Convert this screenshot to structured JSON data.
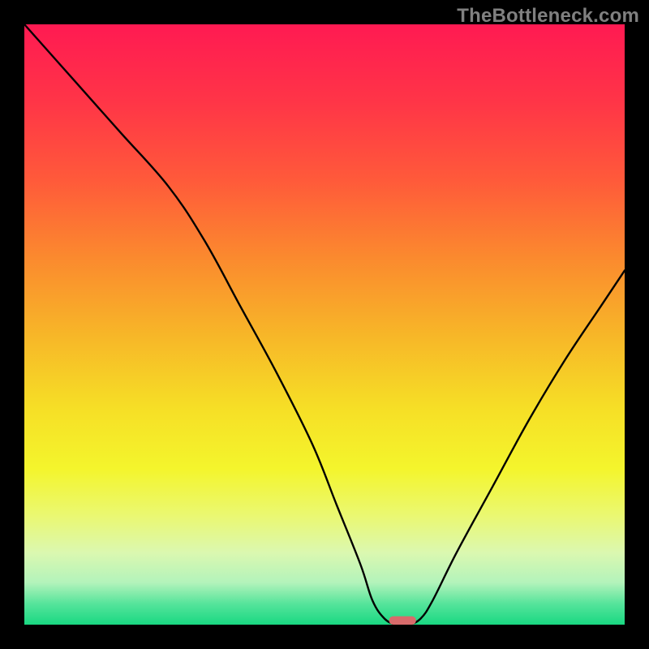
{
  "watermark": "TheBottleneck.com",
  "chart_data": {
    "type": "line",
    "title": "",
    "xlabel": "",
    "ylabel": "",
    "xlim": [
      0,
      100
    ],
    "ylim": [
      0,
      100
    ],
    "grid": false,
    "legend": false,
    "series": [
      {
        "name": "bottleneck-curve",
        "x": [
          0,
          8,
          16,
          24,
          30,
          36,
          42,
          48,
          52,
          56,
          58,
          60,
          62,
          64,
          66,
          68,
          72,
          78,
          84,
          90,
          96,
          100
        ],
        "y": [
          100,
          91,
          82,
          73,
          64,
          53,
          42,
          30,
          20,
          10,
          4,
          1,
          0,
          0,
          1,
          4,
          12,
          23,
          34,
          44,
          53,
          59
        ],
        "color": "#000000"
      }
    ],
    "marker": {
      "name": "optimal-marker",
      "x": 63,
      "y": 0.7,
      "width_pct": 4.5,
      "height_pct": 1.4,
      "color": "#d86b6b"
    },
    "background_gradient": {
      "stops": [
        {
          "offset": 0.0,
          "color": "#ff1a52"
        },
        {
          "offset": 0.13,
          "color": "#ff3547"
        },
        {
          "offset": 0.26,
          "color": "#ff5a3a"
        },
        {
          "offset": 0.39,
          "color": "#fb8a2e"
        },
        {
          "offset": 0.52,
          "color": "#f7b728"
        },
        {
          "offset": 0.64,
          "color": "#f6df26"
        },
        {
          "offset": 0.74,
          "color": "#f4f52c"
        },
        {
          "offset": 0.82,
          "color": "#eaf873"
        },
        {
          "offset": 0.88,
          "color": "#dbf8b0"
        },
        {
          "offset": 0.93,
          "color": "#b3f3bb"
        },
        {
          "offset": 0.965,
          "color": "#56e49b"
        },
        {
          "offset": 1.0,
          "color": "#19d882"
        }
      ]
    }
  }
}
